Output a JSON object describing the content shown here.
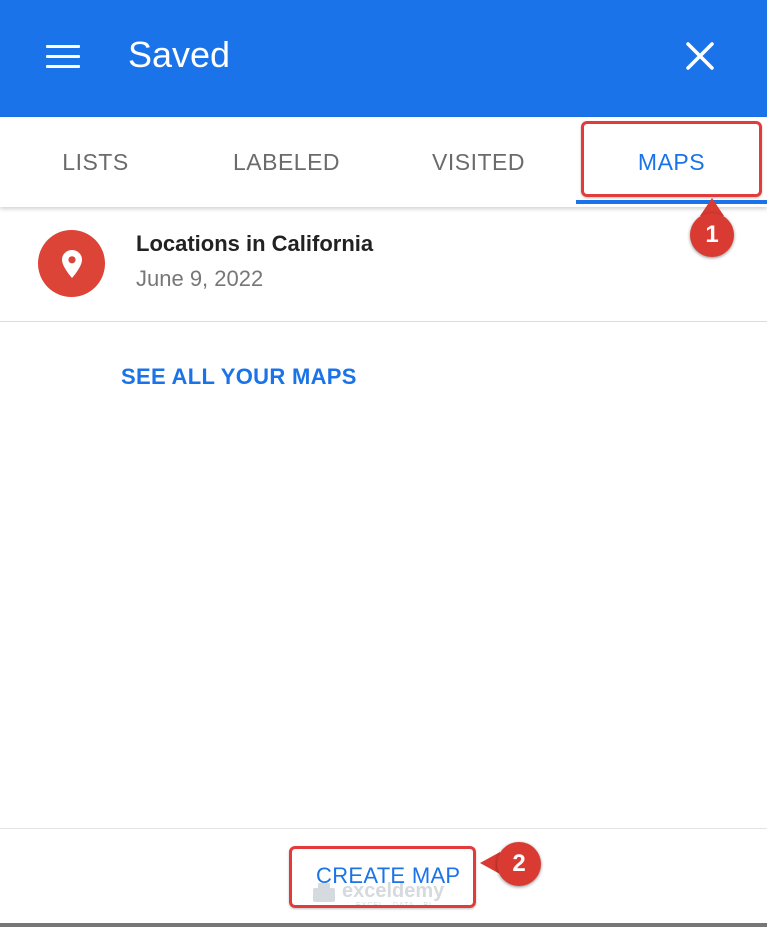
{
  "header": {
    "title": "Saved",
    "background_color": "#1a73e8",
    "menu_icon": "menu-icon",
    "close_icon": "close-icon"
  },
  "tabs": [
    {
      "label": "LISTS",
      "selected": false
    },
    {
      "label": "LABELED",
      "selected": false
    },
    {
      "label": "VISITED",
      "selected": false
    },
    {
      "label": "MAPS",
      "selected": true
    }
  ],
  "maps": [
    {
      "title": "Locations in California",
      "date": "June 9, 2022",
      "icon": "map-pin-icon",
      "icon_color": "#db4437"
    }
  ],
  "see_all_label": "SEE ALL YOUR MAPS",
  "footer": {
    "create_map_label": "CREATE MAP"
  },
  "annotations": {
    "step1": "1",
    "step2": "2",
    "color": "#e23b3b"
  },
  "watermark": {
    "text": "exceldemy",
    "tagline": "EXCEL · DATA · BI"
  }
}
